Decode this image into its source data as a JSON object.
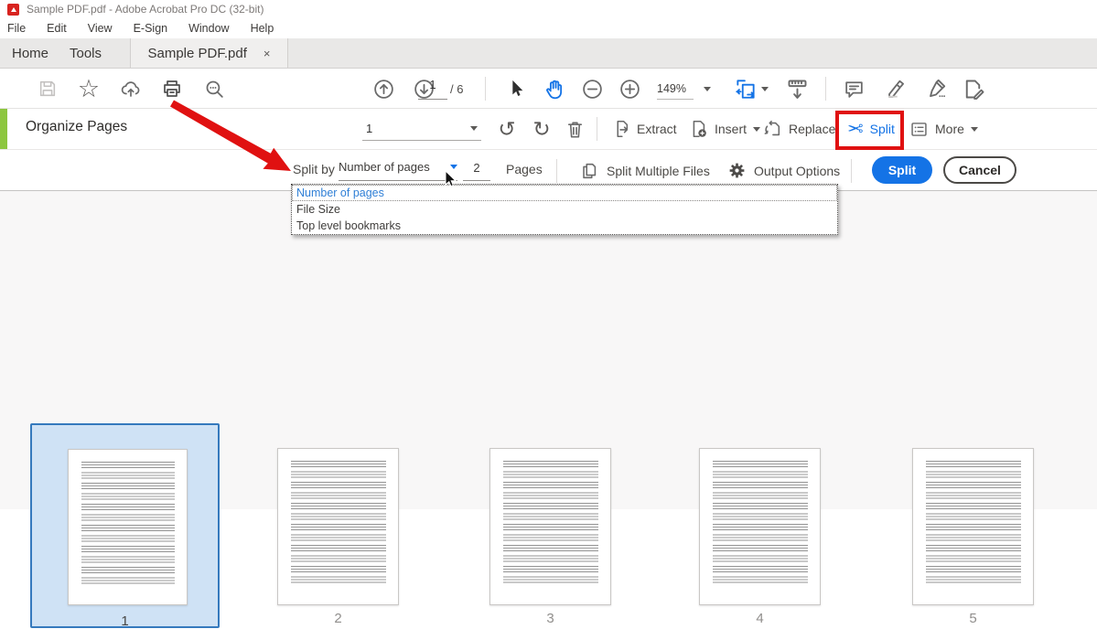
{
  "window": {
    "title": "Sample PDF.pdf - Adobe Acrobat Pro DC (32-bit)"
  },
  "menubar": {
    "items": [
      "File",
      "Edit",
      "View",
      "E-Sign",
      "Window",
      "Help"
    ]
  },
  "tabbar": {
    "home": "Home",
    "tools": "Tools",
    "document_tab": "Sample PDF.pdf",
    "close": "×"
  },
  "toolbar": {
    "page_number": "1",
    "page_total": "/ 6",
    "zoom_level": "149%"
  },
  "organize": {
    "title": "Organize Pages",
    "page_range": "1",
    "extract": "Extract",
    "insert": "Insert",
    "replace": "Replace",
    "split": "Split",
    "more": "More"
  },
  "splitbar": {
    "split_by": "Split by",
    "method_value": "Number of pages",
    "count_value": "2",
    "unit": "Pages",
    "split_multiple": "Split Multiple Files",
    "output_options": "Output Options",
    "split_button": "Split",
    "cancel_button": "Cancel"
  },
  "dropdown": {
    "items": [
      "Number of pages",
      "File Size",
      "Top level bookmarks"
    ]
  },
  "thumbnails": {
    "pages": [
      "1",
      "2",
      "3",
      "4",
      "5"
    ],
    "selected_page": "1"
  },
  "icons": {
    "rotate_left": "↺",
    "rotate_right": "↻",
    "scissors": "✂",
    "star": "☆"
  },
  "colors": {
    "accent_blue": "#1473e6",
    "annotation_red": "#e01111",
    "green_strip": "#8dc63f"
  }
}
